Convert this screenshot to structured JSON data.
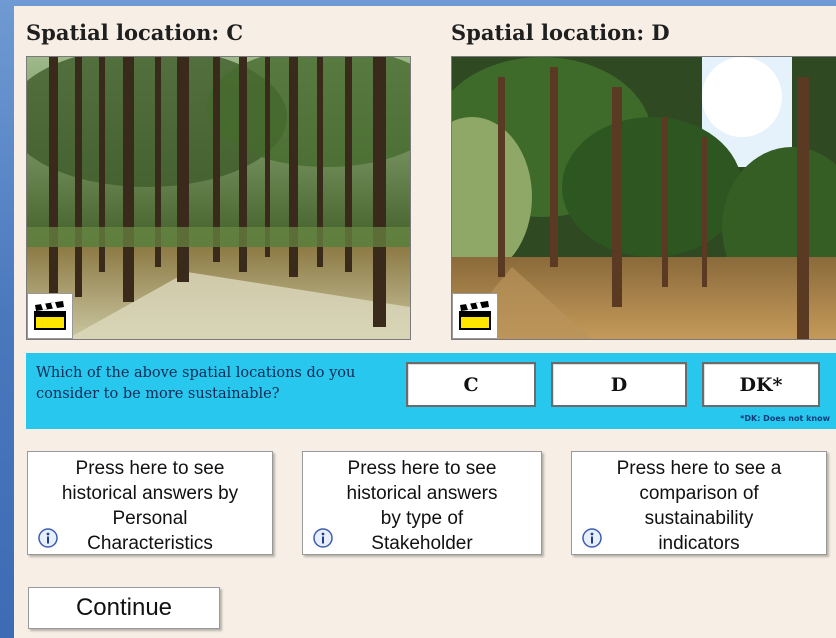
{
  "locations": [
    {
      "title": "Spatial location: C"
    },
    {
      "title": "Spatial location: D"
    }
  ],
  "question": {
    "text": "Which of the above spatial locations do you  consider  to be more sustainable?",
    "options": [
      "C",
      "D",
      "DK*"
    ],
    "note": "*DK: Does not know"
  },
  "history_buttons": [
    {
      "label": "Press here to see\nhistorical answers by\nPersonal\nCharacteristics",
      "icon": "info-icon"
    },
    {
      "label": "Press here to see\nhistorical answers\nby type of\nStakeholder",
      "icon": "info-icon"
    },
    {
      "label": "Press here to see a\ncomparison of\nsustainability\nindicators",
      "icon": "info-icon"
    }
  ],
  "continue_label": "Continue",
  "colors": {
    "band": "#27c7ee",
    "panel": "#f7efe6",
    "background": "#4a78bd"
  }
}
